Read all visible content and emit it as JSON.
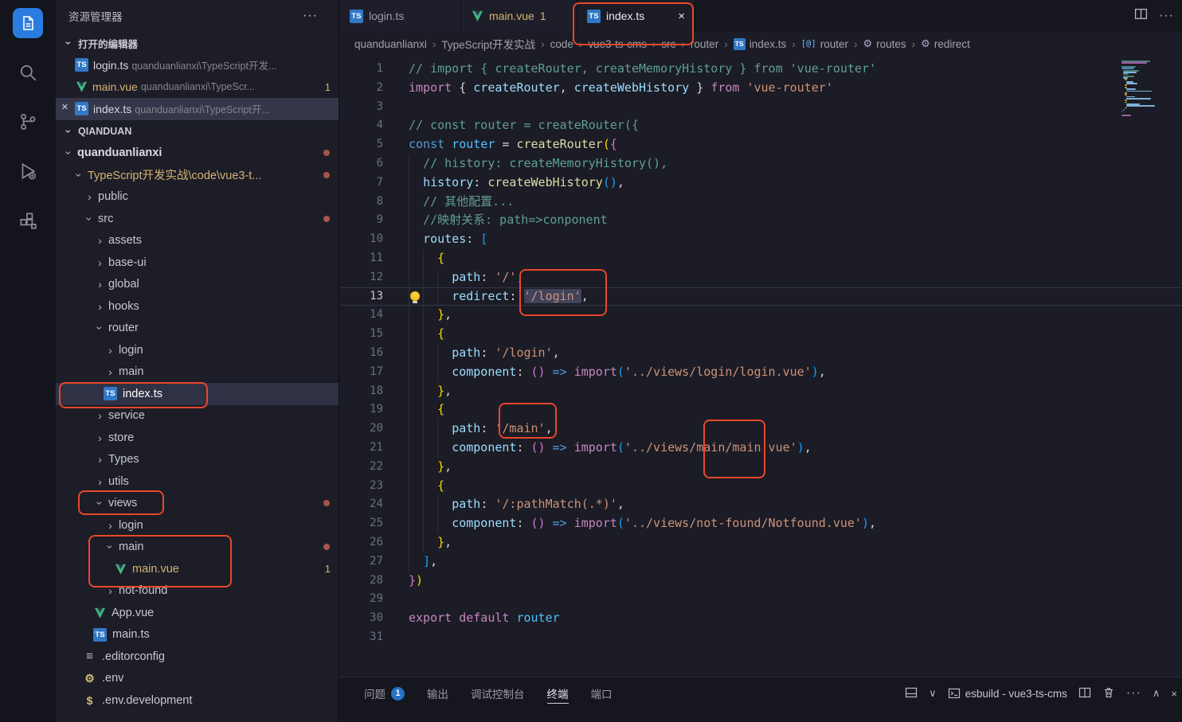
{
  "activity_bar": {
    "items": [
      {
        "key": "explorer",
        "active": true
      },
      {
        "key": "search",
        "active": false
      },
      {
        "key": "source-control",
        "active": false
      },
      {
        "key": "run-debug",
        "active": false
      },
      {
        "key": "extensions",
        "active": false
      }
    ]
  },
  "sidebar": {
    "title": "资源管理器",
    "open_editors": {
      "header": "打开的编辑器",
      "items": [
        {
          "icon": "ts",
          "label": "login.ts",
          "detail": "quanduanlianxi\\TypeScript开发...",
          "selected": false
        },
        {
          "icon": "vue",
          "label": "main.vue",
          "detail": "quanduanlianxi\\TypeScr...",
          "badge": "1",
          "modified": true,
          "selected": false
        },
        {
          "icon": "ts",
          "label": "index.ts",
          "detail": "quanduanlianxi\\TypeScript开...",
          "close": "×",
          "selected": true
        }
      ]
    },
    "section": {
      "header": "QIANDUAN",
      "items": [
        {
          "label": "quanduanlianxi",
          "kind": "folder",
          "state": "expanded",
          "level": 0,
          "dot": true,
          "bold": true
        },
        {
          "label": "TypeScript开发实战\\code\\vue3-t...",
          "kind": "folder",
          "state": "expanded",
          "level": 1,
          "dot": true,
          "modified": true
        },
        {
          "label": "public",
          "kind": "folder",
          "state": "collapsed",
          "level": 2
        },
        {
          "label": "src",
          "kind": "folder",
          "state": "expanded",
          "level": 2,
          "dot": true
        },
        {
          "label": "assets",
          "kind": "folder",
          "state": "collapsed",
          "level": 3
        },
        {
          "label": "base-ui",
          "kind": "folder",
          "state": "collapsed",
          "level": 3
        },
        {
          "label": "global",
          "kind": "folder",
          "state": "collapsed",
          "level": 3
        },
        {
          "label": "hooks",
          "kind": "folder",
          "state": "collapsed",
          "level": 3
        },
        {
          "label": "router",
          "kind": "folder",
          "state": "expanded",
          "level": 3
        },
        {
          "label": "login",
          "kind": "folder",
          "state": "collapsed",
          "level": 4
        },
        {
          "label": "main",
          "kind": "folder",
          "state": "collapsed",
          "level": 4
        },
        {
          "label": "index.ts",
          "kind": "ts",
          "level": 4,
          "selected": true
        },
        {
          "label": "service",
          "kind": "folder",
          "state": "collapsed",
          "level": 3
        },
        {
          "label": "store",
          "kind": "folder",
          "state": "collapsed",
          "level": 3
        },
        {
          "label": "Types",
          "kind": "folder",
          "state": "collapsed",
          "level": 3
        },
        {
          "label": "utils",
          "kind": "folder",
          "state": "collapsed",
          "level": 3
        },
        {
          "label": "views",
          "kind": "folder",
          "state": "expanded",
          "level": 3,
          "dot": true
        },
        {
          "label": "login",
          "kind": "folder",
          "state": "collapsed",
          "level": 4
        },
        {
          "label": "main",
          "kind": "folder",
          "state": "expanded",
          "level": 4,
          "dot": true
        },
        {
          "label": "main.vue",
          "kind": "vue",
          "level": 5,
          "modified": true,
          "badge": "1"
        },
        {
          "label": "not-found",
          "kind": "folder",
          "state": "collapsed",
          "level": 4
        },
        {
          "label": "App.vue",
          "kind": "vue",
          "level": 3
        },
        {
          "label": "main.ts",
          "kind": "ts",
          "level": 3
        },
        {
          "label": ".editorconfig",
          "kind": "editorconfig",
          "level": 2
        },
        {
          "label": ".env",
          "kind": "env",
          "level": 2
        },
        {
          "label": ".env.development",
          "kind": "env-dev",
          "level": 2
        }
      ]
    }
  },
  "tabs": [
    {
      "icon": "ts",
      "label": "login.ts",
      "active": false
    },
    {
      "icon": "vue",
      "label": "main.vue",
      "badge": "1",
      "modified": true,
      "active": false
    },
    {
      "icon": "ts",
      "label": "index.ts",
      "active": true,
      "close": "×"
    }
  ],
  "breadcrumb": {
    "items": [
      {
        "label": "quanduanlianxi"
      },
      {
        "label": "TypeScript开发实战"
      },
      {
        "label": "code"
      },
      {
        "label": "vue3-ts-cms"
      },
      {
        "label": "src"
      },
      {
        "label": "router"
      },
      {
        "label": "index.ts",
        "icon": "ts"
      },
      {
        "label": "router",
        "icon": "symbol-var"
      },
      {
        "label": "routes",
        "icon": "symbol-prop"
      },
      {
        "label": "redirect",
        "icon": "symbol-prop"
      }
    ]
  },
  "editor": {
    "code": {
      "lines": [
        {
          "n": 1,
          "indent": 0,
          "tokens": [
            [
              "cm",
              "// import { createRouter, createMemoryHistory } from 'vue-router'"
            ]
          ]
        },
        {
          "n": 2,
          "indent": 0,
          "tokens": [
            [
              "kw",
              "import"
            ],
            [
              "pn",
              " { "
            ],
            [
              "vb",
              "createRouter"
            ],
            [
              "pn",
              ", "
            ],
            [
              "vb",
              "createWebHistory"
            ],
            [
              "pn",
              " } "
            ],
            [
              "kw",
              "from"
            ],
            [
              "pn",
              " "
            ],
            [
              "st",
              "'vue-router'"
            ]
          ]
        },
        {
          "n": 3,
          "indent": 0,
          "tokens": []
        },
        {
          "n": 4,
          "indent": 0,
          "tokens": [
            [
              "cm",
              "// const router = createRouter({"
            ]
          ]
        },
        {
          "n": 5,
          "indent": 0,
          "tokens": [
            [
              "cb",
              "const"
            ],
            [
              "pn",
              " "
            ],
            [
              "vc",
              "router"
            ],
            [
              "pn",
              " = "
            ],
            [
              "fn",
              "createRouter"
            ],
            [
              "b1",
              "("
            ],
            [
              "b2",
              "{"
            ]
          ]
        },
        {
          "n": 6,
          "indent": 1,
          "tokens": [
            [
              "cm",
              "// history: createMemoryHistory(),"
            ]
          ]
        },
        {
          "n": 7,
          "indent": 1,
          "tokens": [
            [
              "vb",
              "history"
            ],
            [
              "pn",
              ": "
            ],
            [
              "fn",
              "createWebHistory"
            ],
            [
              "b3",
              "()"
            ],
            [
              "pn",
              ","
            ]
          ]
        },
        {
          "n": 8,
          "indent": 1,
          "tokens": [
            [
              "cm",
              "// 其他配置..."
            ]
          ]
        },
        {
          "n": 9,
          "indent": 1,
          "tokens": [
            [
              "cm",
              "//映射关系: path=>conponent"
            ]
          ]
        },
        {
          "n": 10,
          "indent": 1,
          "tokens": [
            [
              "vb",
              "routes"
            ],
            [
              "pn",
              ": "
            ],
            [
              "b3",
              "["
            ]
          ]
        },
        {
          "n": 11,
          "indent": 2,
          "tokens": [
            [
              "b1",
              "{"
            ]
          ]
        },
        {
          "n": 12,
          "indent": 3,
          "tokens": [
            [
              "vb",
              "path"
            ],
            [
              "pn",
              ": "
            ],
            [
              "st",
              "'/'"
            ],
            [
              "pn",
              ","
            ]
          ]
        },
        {
          "n": 13,
          "indent": 3,
          "current": true,
          "lightbulb": true,
          "tokens": [
            [
              "vb",
              "redirect"
            ],
            [
              "pn",
              ": "
            ],
            [
              "sth",
              "'/login'"
            ],
            [
              "pn",
              ","
            ]
          ]
        },
        {
          "n": 14,
          "indent": 2,
          "tokens": [
            [
              "b1",
              "}"
            ],
            [
              "pn",
              ","
            ]
          ]
        },
        {
          "n": 15,
          "indent": 2,
          "tokens": [
            [
              "b1",
              "{"
            ]
          ]
        },
        {
          "n": 16,
          "indent": 3,
          "tokens": [
            [
              "vb",
              "path"
            ],
            [
              "pn",
              ": "
            ],
            [
              "st",
              "'/login'"
            ],
            [
              "pn",
              ","
            ]
          ]
        },
        {
          "n": 17,
          "indent": 3,
          "tokens": [
            [
              "vb",
              "component"
            ],
            [
              "pn",
              ": "
            ],
            [
              "b2",
              "()"
            ],
            [
              "pn",
              " "
            ],
            [
              "op",
              "=>"
            ],
            [
              "pn",
              " "
            ],
            [
              "kw",
              "import"
            ],
            [
              "b3",
              "("
            ],
            [
              "st",
              "'../views/login/login.vue'"
            ],
            [
              "b3",
              ")"
            ],
            [
              "pn",
              ","
            ]
          ]
        },
        {
          "n": 18,
          "indent": 2,
          "tokens": [
            [
              "b1",
              "}"
            ],
            [
              "pn",
              ","
            ]
          ]
        },
        {
          "n": 19,
          "indent": 2,
          "tokens": [
            [
              "b1",
              "{"
            ]
          ]
        },
        {
          "n": 20,
          "indent": 3,
          "tokens": [
            [
              "vb",
              "path"
            ],
            [
              "pn",
              ": "
            ],
            [
              "st",
              "'/main'"
            ],
            [
              "pn",
              ","
            ]
          ]
        },
        {
          "n": 21,
          "indent": 3,
          "tokens": [
            [
              "vb",
              "component"
            ],
            [
              "pn",
              ": "
            ],
            [
              "b2",
              "()"
            ],
            [
              "pn",
              " "
            ],
            [
              "op",
              "=>"
            ],
            [
              "pn",
              " "
            ],
            [
              "kw",
              "import"
            ],
            [
              "b3",
              "("
            ],
            [
              "st",
              "'../views/main/main.vue'"
            ],
            [
              "b3",
              ")"
            ],
            [
              "pn",
              ","
            ]
          ]
        },
        {
          "n": 22,
          "indent": 2,
          "tokens": [
            [
              "b1",
              "}"
            ],
            [
              "pn",
              ","
            ]
          ]
        },
        {
          "n": 23,
          "indent": 2,
          "tokens": [
            [
              "b1",
              "{"
            ]
          ]
        },
        {
          "n": 24,
          "indent": 3,
          "tokens": [
            [
              "vb",
              "path"
            ],
            [
              "pn",
              ": "
            ],
            [
              "st",
              "'/:pathMatch(.*)'"
            ],
            [
              "pn",
              ","
            ]
          ]
        },
        {
          "n": 25,
          "indent": 3,
          "tokens": [
            [
              "vb",
              "component"
            ],
            [
              "pn",
              ": "
            ],
            [
              "b2",
              "()"
            ],
            [
              "pn",
              " "
            ],
            [
              "op",
              "=>"
            ],
            [
              "pn",
              " "
            ],
            [
              "kw",
              "import"
            ],
            [
              "b3",
              "("
            ],
            [
              "st",
              "'../views/not-found/Notfound.vue'"
            ],
            [
              "b3",
              ")"
            ],
            [
              "pn",
              ","
            ]
          ]
        },
        {
          "n": 26,
          "indent": 2,
          "tokens": [
            [
              "b1",
              "}"
            ],
            [
              "pn",
              ","
            ]
          ]
        },
        {
          "n": 27,
          "indent": 1,
          "tokens": [
            [
              "b3",
              "]"
            ],
            [
              "pn",
              ","
            ]
          ]
        },
        {
          "n": 28,
          "indent": 0,
          "tokens": [
            [
              "b2",
              "}"
            ],
            [
              "b1",
              ")"
            ]
          ]
        },
        {
          "n": 29,
          "indent": 0,
          "tokens": []
        },
        {
          "n": 30,
          "indent": 0,
          "tokens": [
            [
              "kw",
              "export"
            ],
            [
              "pn",
              " "
            ],
            [
              "kw",
              "default"
            ],
            [
              "pn",
              " "
            ],
            [
              "vc",
              "router"
            ]
          ]
        },
        {
          "n": 31,
          "indent": 0,
          "tokens": []
        }
      ]
    }
  },
  "panel": {
    "tabs": [
      {
        "key": "problems",
        "label": "问题",
        "badge": "1"
      },
      {
        "key": "output",
        "label": "输出"
      },
      {
        "key": "debug-console",
        "label": "调试控制台"
      },
      {
        "key": "terminal",
        "label": "终端",
        "active": true
      },
      {
        "key": "ports",
        "label": "端口"
      }
    ],
    "terminal_name": "esbuild - vue3-ts-cms"
  }
}
